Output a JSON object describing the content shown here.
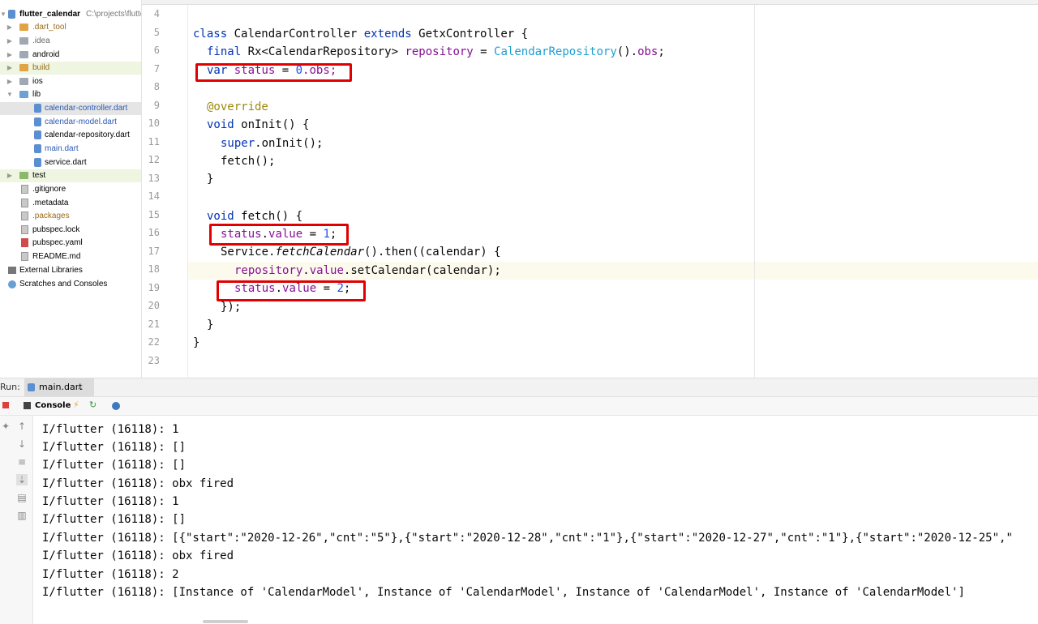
{
  "project": {
    "root_name": "flutter_calendar",
    "root_path": "C:\\projects\\flutte",
    "items": [
      {
        "name": ".dart_tool",
        "type": "folder",
        "color": "orange"
      },
      {
        "name": ".idea",
        "type": "folder",
        "color": "gray"
      },
      {
        "name": "android",
        "type": "folder",
        "color": "gray"
      },
      {
        "name": "build",
        "type": "folder",
        "color": "orange"
      },
      {
        "name": "ios",
        "type": "folder",
        "color": "gray"
      },
      {
        "name": "lib",
        "type": "folder",
        "color": "blue"
      },
      {
        "name": "calendar-controller.dart",
        "type": "dart"
      },
      {
        "name": "calendar-model.dart",
        "type": "dart"
      },
      {
        "name": "calendar-repository.dart",
        "type": "dart"
      },
      {
        "name": "main.dart",
        "type": "dart"
      },
      {
        "name": "service.dart",
        "type": "dart"
      },
      {
        "name": "test",
        "type": "folder",
        "color": "green"
      },
      {
        "name": ".gitignore",
        "type": "file"
      },
      {
        "name": ".metadata",
        "type": "file"
      },
      {
        "name": ".packages",
        "type": "file"
      },
      {
        "name": "pubspec.lock",
        "type": "file"
      },
      {
        "name": "pubspec.yaml",
        "type": "yaml"
      },
      {
        "name": "README.md",
        "type": "file"
      },
      {
        "name": "External Libraries",
        "type": "libs"
      },
      {
        "name": "Scratches and Consoles",
        "type": "scratch"
      }
    ]
  },
  "editor": {
    "line_numbers": [
      "4",
      "5",
      "6",
      "7",
      "8",
      "9",
      "10",
      "11",
      "12",
      "13",
      "14",
      "15",
      "16",
      "17",
      "18",
      "19",
      "20",
      "21",
      "22",
      "23"
    ],
    "l5": {
      "k1": "class",
      "n": " CalendarController ",
      "k2": "extends",
      "rest": " GetxController {"
    },
    "l6": {
      "k": "final",
      "t": " Rx<CalendarRepository> ",
      "f": "repository",
      "eq": " = ",
      "c": "CalendarRepository",
      "end": "().",
      "obs": "obs",
      "semi": ";"
    },
    "l7": {
      "k": "var",
      "f": " status",
      "eq": " = ",
      "n": "0",
      "end": ".obs;"
    },
    "l9": {
      "a": "@override"
    },
    "l10": {
      "k": "void",
      "rest": " onInit() {"
    },
    "l11": {
      "k": "super",
      "rest": ".onInit();"
    },
    "l12": {
      "rest": "fetch();"
    },
    "l13": {
      "rest": "}"
    },
    "l15": {
      "k": "void",
      "rest": " fetch() {"
    },
    "l16": {
      "f1": "status",
      "dot": ".",
      "f2": "value",
      "eq": " = ",
      "n": "1",
      "end": ";"
    },
    "l17": {
      "a": "Service.",
      "i": "fetchCalendar",
      "rest": "().then((calendar) {"
    },
    "l18": {
      "f1": "repository",
      "dot": ".",
      "f2": "value",
      "rest": ".setCalendar(calendar);"
    },
    "l19": {
      "f1": "status",
      "dot": ".",
      "f2": "value",
      "eq": " = ",
      "n": "2",
      "end": ";"
    },
    "l20": {
      "rest": "});"
    },
    "l21": {
      "rest": "}"
    },
    "l22": {
      "rest": "}"
    }
  },
  "run": {
    "label": "Run:",
    "tab": "main.dart",
    "close": "×",
    "console": "Console",
    "lines": [
      "I/flutter (16118): 1",
      "I/flutter (16118): []",
      "I/flutter (16118): []",
      "I/flutter (16118): obx fired",
      "I/flutter (16118): 1",
      "I/flutter (16118): []",
      "I/flutter (16118): [{\"start\":\"2020-12-26\",\"cnt\":\"5\"},{\"start\":\"2020-12-28\",\"cnt\":\"1\"},{\"start\":\"2020-12-27\",\"cnt\":\"1\"},{\"start\":\"2020-12-25\",\"",
      "I/flutter (16118): obx fired",
      "I/flutter (16118): 2",
      "I/flutter (16118): [Instance of 'CalendarModel', Instance of 'CalendarModel', Instance of 'CalendarModel', Instance of 'CalendarModel']"
    ]
  },
  "colors": {
    "highlight_box": "#e00000",
    "keyword": "#0033b3",
    "field": "#871094",
    "number": "#1750eb"
  }
}
